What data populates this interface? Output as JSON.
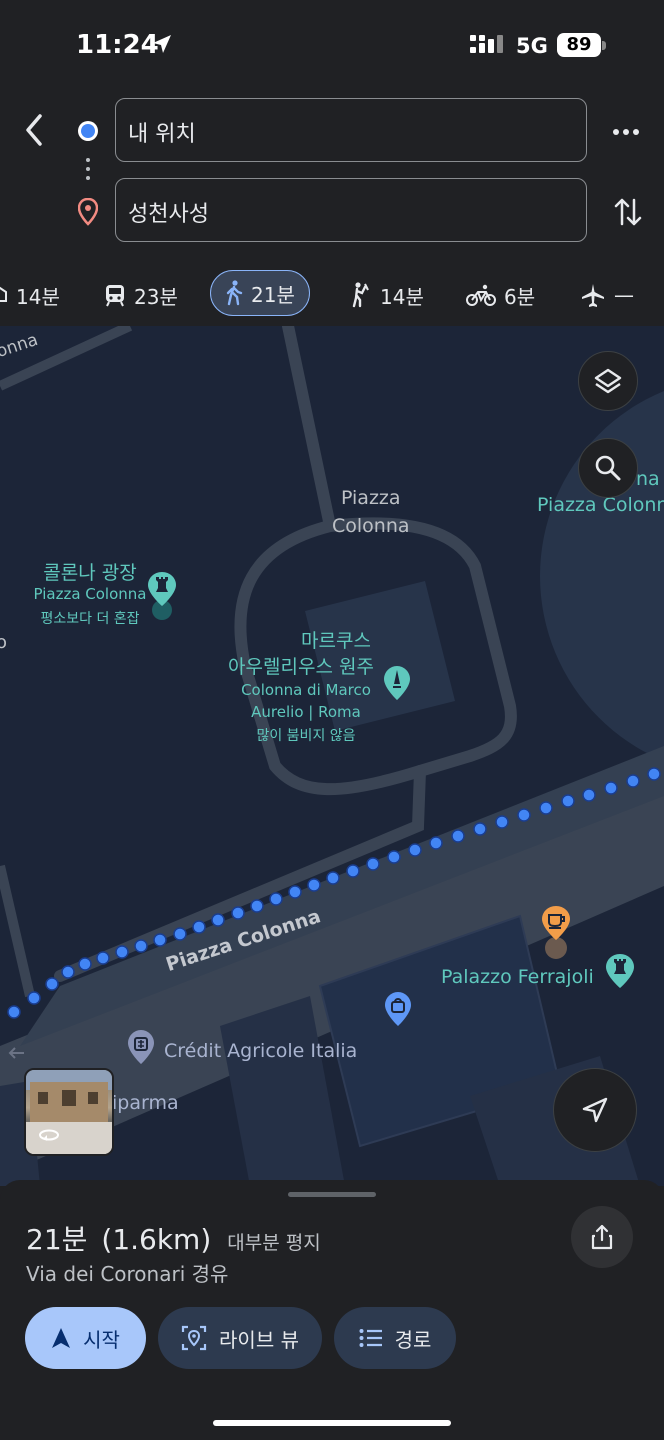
{
  "status": {
    "time": "11:24",
    "network": "5G",
    "battery": "89"
  },
  "search": {
    "origin": "내 위치",
    "destination": "성천사성"
  },
  "modes": [
    {
      "label": "14분",
      "icon": "car-icon"
    },
    {
      "label": "23분",
      "icon": "transit-icon"
    },
    {
      "label": "21분",
      "icon": "walk-icon",
      "active": true
    },
    {
      "label": "14분",
      "icon": "ride-icon"
    },
    {
      "label": "6분",
      "icon": "bike-icon"
    },
    {
      "label": "—",
      "icon": "flight-icon"
    }
  ],
  "map": {
    "labels": {
      "partial_top": "onna",
      "piazza_colonna_area": "Piazza\nColonna",
      "piazza_colonna_right": "Piazza Colonn",
      "right_partial": "na",
      "colonna_square_ko": "콜론나 광장",
      "colonna_square_it": "Piazza Colonna",
      "colonna_square_busy": "평소보다 더 혼잡",
      "marcus_ko_1": "마르쿠스",
      "marcus_ko_2": "아우렐리우스 원주",
      "marcus_it_1": "Colonna di Marco",
      "marcus_it_2": "Aurelio | Roma",
      "marcus_busy": "많이 붐비지 않음",
      "street": "Piazza Colonna",
      "palazzo": "Palazzo Ferrajoli",
      "credit": "Crédit Agricole Italia",
      "iparma": "iparma",
      "left_partial": "o"
    },
    "colors": {
      "route": "#4285f4",
      "teal_poi": "#5fc8bd",
      "food_poi": "#f29d49",
      "shop_poi": "#5e97f6",
      "bank_poi": "#8a94b8",
      "land": "#1c2538",
      "road": "#3a4454",
      "park": "#27344a"
    }
  },
  "sheet": {
    "duration": "21분",
    "distance": "(1.6km)",
    "terrain": "대부분 평지",
    "via": "Via dei Coronari 경유",
    "buttons": {
      "start": "시작",
      "live_view": "라이브 뷰",
      "steps": "경로"
    }
  }
}
